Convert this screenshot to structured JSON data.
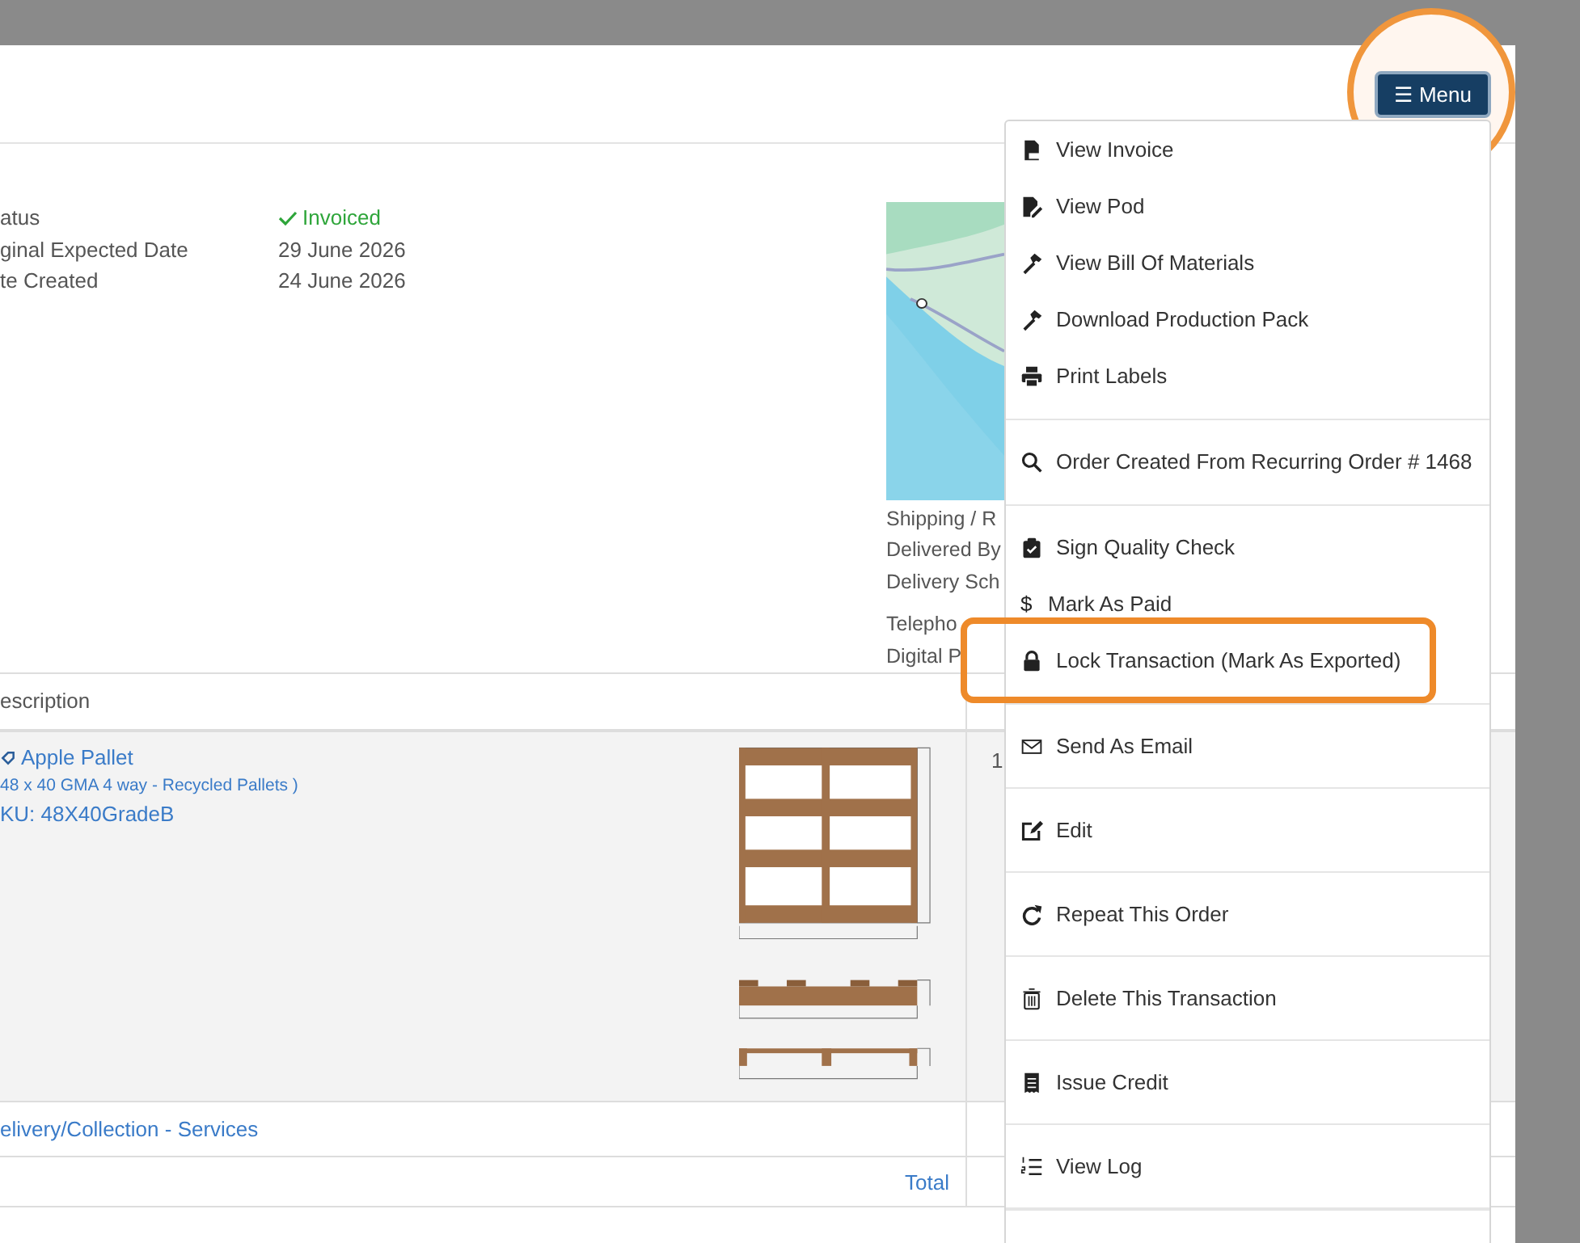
{
  "header": {
    "menu_button": {
      "label": "Menu",
      "icon": "☰",
      "annotated": true
    }
  },
  "info": [
    {
      "kind": "status",
      "label": "atus",
      "value": "Invoiced"
    },
    {
      "kind": "text",
      "label": "ginal Expected Date",
      "value": "29 June 2026"
    },
    {
      "kind": "text",
      "label": "te Created",
      "value": "24 June 2026"
    }
  ],
  "map": {
    "kind": "picture"
  },
  "shipping": [
    "Shipping / R",
    "Delivered By",
    "Delivery Sch",
    "Telepho",
    "Digital P"
  ],
  "table": {
    "columns": [
      "escription"
    ],
    "rows": [
      {
        "kind": "product",
        "name": "Apple Pallet",
        "detail": "48 x 40 GMA 4 way - Recycled Pallets )",
        "sku": "KU: 48X40GradeB",
        "qty": "1"
      },
      {
        "kind": "service",
        "name": "elivery/Collection - Services"
      }
    ],
    "total_label": "Total"
  },
  "menu": {
    "groups": [
      {
        "kind": "compact",
        "items": [
          {
            "label": "View Invoice",
            "highlighted": false
          },
          {
            "label": "View Pod",
            "highlighted": false
          },
          {
            "label": "View Bill Of Materials",
            "highlighted": false
          },
          {
            "label": "Download Production Pack",
            "highlighted": false
          },
          {
            "label": "Print Labels",
            "highlighted": false
          }
        ]
      },
      {
        "kind": "compact",
        "items": [
          {
            "label": "Order Created From Recurring Order # 1468",
            "highlighted": false
          }
        ]
      },
      {
        "kind": "compact",
        "items": [
          {
            "label": "Sign Quality Check",
            "highlighted": false
          },
          {
            "label": "Mark As Paid",
            "glyph": "$",
            "highlighted": false
          },
          {
            "label": "Lock Transaction (Mark As Exported)",
            "highlighted": true
          }
        ]
      },
      {
        "kind": "spaced",
        "items": [
          {
            "label": "Send As Email",
            "highlighted": false
          },
          {
            "label": "Edit",
            "highlighted": false
          },
          {
            "label": "Repeat This Order",
            "highlighted": false
          },
          {
            "label": "Delete This Transaction",
            "highlighted": false
          },
          {
            "label": "Issue Credit",
            "highlighted": false
          },
          {
            "label": "View Log",
            "highlighted": false
          }
        ]
      }
    ]
  }
}
